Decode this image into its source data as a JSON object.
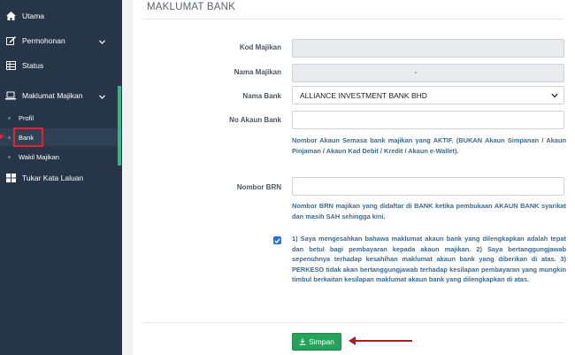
{
  "sidebar": {
    "items": [
      {
        "label": "Utama",
        "icon": "home-icon"
      },
      {
        "label": "Permohonan",
        "icon": "edit-icon"
      },
      {
        "label": "Status",
        "icon": "table-icon"
      },
      {
        "label": "Maklumat Majikan",
        "icon": "laptop-icon"
      },
      {
        "label": "Tukar Kata Laluan",
        "icon": "windows-icon"
      }
    ],
    "subitems": [
      {
        "label": "Profil"
      },
      {
        "label": "Bank"
      },
      {
        "label": "Wakil Majikan"
      }
    ]
  },
  "panel": {
    "title": "MAKLUMAT BANK"
  },
  "form": {
    "kod_majikan_label": "Kod Majikan",
    "kod_majikan_value": "",
    "nama_majikan_label": "Nama Majikan",
    "nama_majikan_value": "",
    "nama_bank_label": "Nama Bank",
    "nama_bank_value": "ALLIANCE INVESTMENT BANK BHD",
    "no_akaun_label": "No Akaun Bank",
    "no_akaun_value": "",
    "no_akaun_help": "Nombor Akaun Semasa bank majikan yang AKTIF. (BUKAN Akaun Simpanan / Akaun Pinjaman / Akaun Kad Debit / Kredit / Akaun e-Wallet).",
    "brn_label": "Nombor BRN",
    "brn_value": "",
    "brn_help": "Nombor BRN majikan yang didaftar di BANK ketika pembukaan AKAUN BANK syarikat dan masih SAH sehingga kini.",
    "declaration": "1) Saya mengesahkan bahawa maklumat akaun bank yang dilengkapkan adalah tepat dan betul bagi pembayaran kepada akaun majikan. 2) Saya bertanggungjawab sepenuhnya terhadap kesahihan maklumat akaun bank yang diberikan di atas. 3) PERKESO tidak akan bertanggungjawab terhadap kesilapan pembayaran yang mungkin timbul berkaitan kesilapan maklumat akaun bank yang dilengkapkan di atas.",
    "declaration_checked": true,
    "submit_label": "Simpan"
  },
  "colors": {
    "sidebar_bg": "#263648",
    "accent": "#36b58a",
    "highlight": "#e3232f",
    "button": "#25a35a",
    "help_text": "#3d6b94"
  }
}
